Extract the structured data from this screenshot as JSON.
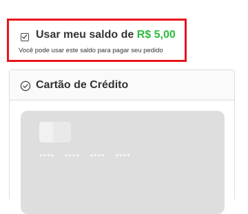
{
  "balance": {
    "label_prefix": "Usar meu saldo de ",
    "amount": "R$ 5,00",
    "hint": "Você pode usar este saldo para pagar seu pedido",
    "checked": true
  },
  "payment_method": {
    "title": "Cartão de Crédito",
    "icon": "check-circle-icon",
    "card_number_mask": "•••• •••• •••• ••••"
  },
  "colors": {
    "highlight_border": "#e8141b",
    "amount": "#2db83d",
    "text": "#333333",
    "card_placeholder": "#dedede"
  }
}
